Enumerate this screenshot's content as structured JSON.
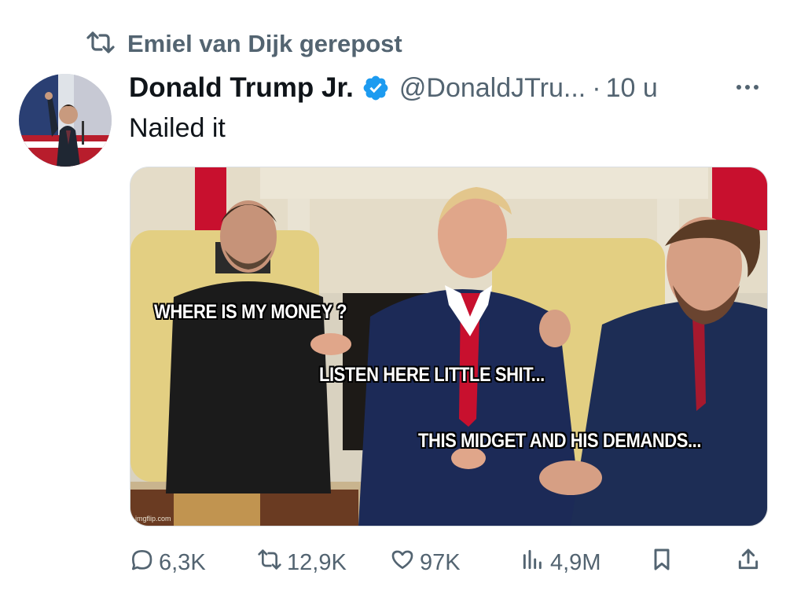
{
  "repost": {
    "text": "Emiel van Dijk gerepost"
  },
  "tweet": {
    "author_name": "Donald Trump Jr.",
    "handle": "@DonaldJTru...",
    "separator": "·",
    "time": "10 u",
    "text": "Nailed it"
  },
  "media": {
    "captions": [
      "WHERE IS MY MONEY ?",
      "LISTEN HERE LITTLE SHIT...",
      "THIS MIDGET AND HIS DEMANDS..."
    ],
    "watermark": "imgflip.com"
  },
  "actions": {
    "replies": "6,3K",
    "reposts": "12,9K",
    "likes": "97K",
    "views": "4,9M"
  },
  "colors": {
    "text_primary": "#0f1419",
    "text_secondary": "#536471",
    "verified_badge": "#1d9bf0"
  },
  "icons": [
    "repost-icon",
    "verified-badge-icon",
    "more-icon",
    "reply-icon",
    "repost-icon",
    "like-icon",
    "views-icon",
    "bookmark-icon",
    "share-icon"
  ]
}
